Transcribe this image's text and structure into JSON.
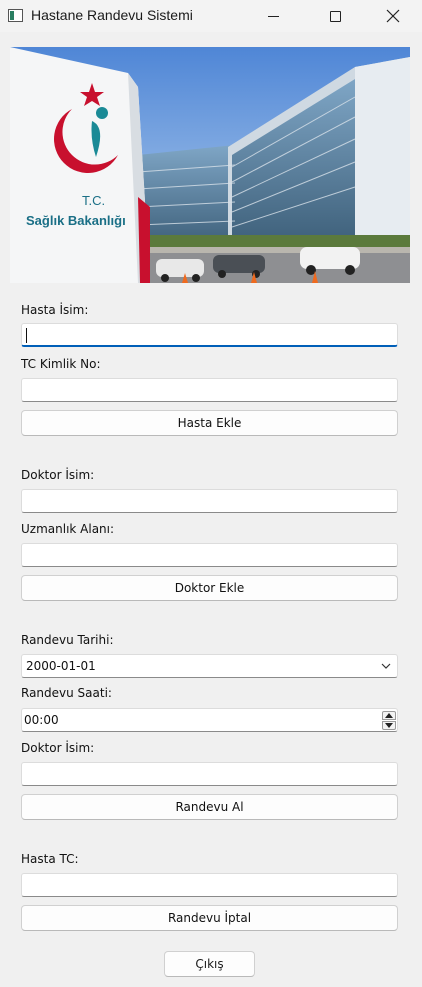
{
  "window": {
    "title": "Hastane Randevu Sistemi",
    "icon": "app-window-icon",
    "controls": [
      "minimize-icon",
      "maximize-icon",
      "close-icon"
    ]
  },
  "banner": {
    "description_icon": "hospital-banner-image",
    "sign_line1": "T.C.",
    "sign_line2": "Sağlık Bakanlığı"
  },
  "patient": {
    "name_label": "Hasta İsim:",
    "name_value": "",
    "tc_label": "TC Kimlik No:",
    "tc_value": "",
    "add_button": "Hasta Ekle"
  },
  "doctor": {
    "name_label": "Doktor İsim:",
    "name_value": "",
    "specialty_label": "Uzmanlık Alanı:",
    "specialty_value": "",
    "add_button": "Doktor Ekle"
  },
  "appointment": {
    "date_label": "Randevu Tarihi:",
    "date_value": "2000-01-01",
    "time_label": "Randevu Saati:",
    "time_value": "00:00",
    "doctor_label": "Doktor İsim:",
    "doctor_value": "",
    "take_button": "Randevu Al"
  },
  "cancel": {
    "tc_label": "Hasta TC:",
    "tc_value": "",
    "cancel_button": "Randevu İptal"
  },
  "exit_button": "Çıkış",
  "colors": {
    "window_bg": "#f0f0f0",
    "focus_accent": "#005fb8",
    "ministry_red": "#c8102e",
    "ministry_teal": "#1a8a96"
  }
}
